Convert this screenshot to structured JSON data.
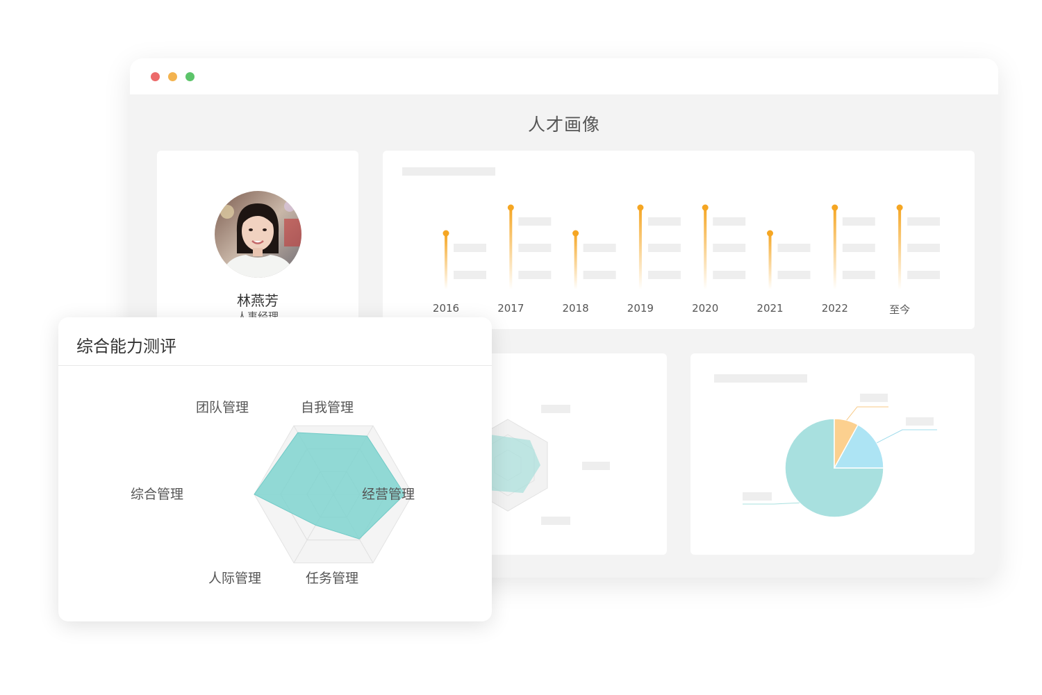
{
  "window": {
    "traffic_lights": [
      "#ec6a6a",
      "#f3b34f",
      "#5cc46a"
    ],
    "page_title": "人才画像"
  },
  "profile": {
    "name": "林燕芳",
    "role": "人事经理",
    "avatar_icon": "person-portrait-icon"
  },
  "timeline": {
    "years": [
      "2016",
      "2017",
      "2018",
      "2019",
      "2020",
      "2021",
      "2022",
      "至今"
    ],
    "accent_color": "#f5a623"
  },
  "assessment": {
    "title": "综合能力测评",
    "axes": [
      "团队管理",
      "自我管理",
      "经营管理",
      "任务管理",
      "人际管理",
      "综合管理"
    ],
    "fill_color": "#7fd3cf",
    "chart_data": {
      "type": "radar",
      "categories": [
        "团队管理",
        "自我管理",
        "经营管理",
        "任务管理",
        "人际管理",
        "综合管理"
      ],
      "values": [
        0.9,
        0.85,
        0.9,
        0.65,
        0.45,
        1.0
      ],
      "ylim": [
        0,
        1
      ]
    }
  },
  "pie": {
    "colors": [
      "#a8e0df",
      "#fcd08f",
      "#ade4f4"
    ],
    "chart_data": {
      "type": "pie",
      "values": [
        75,
        8,
        17
      ]
    }
  }
}
